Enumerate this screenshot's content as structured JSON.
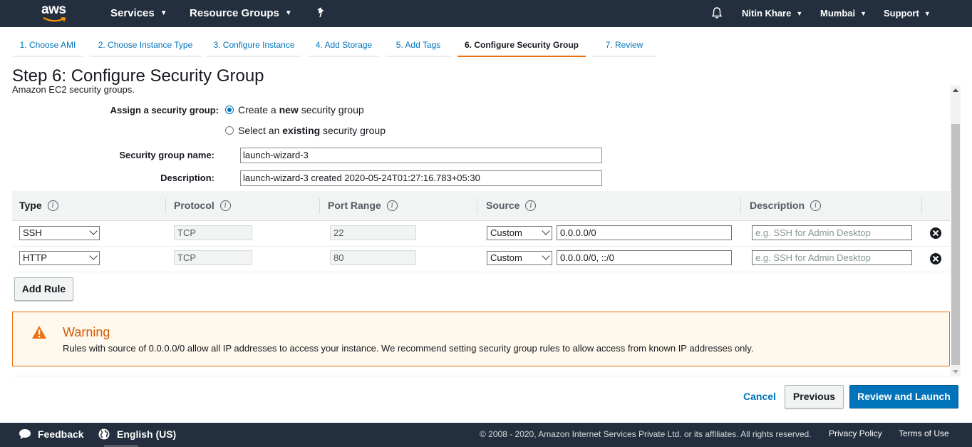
{
  "topnav": {
    "logo_text": "aws",
    "services": "Services",
    "resource_groups": "Resource Groups",
    "user": "Nitin Khare",
    "region": "Mumbai",
    "support": "Support"
  },
  "steps": [
    {
      "label": "1. Choose AMI",
      "active": false
    },
    {
      "label": "2. Choose Instance Type",
      "active": false
    },
    {
      "label": "3. Configure Instance",
      "active": false
    },
    {
      "label": "4. Add Storage",
      "active": false
    },
    {
      "label": "5. Add Tags",
      "active": false
    },
    {
      "label": "6. Configure Security Group",
      "active": true
    },
    {
      "label": "7. Review",
      "active": false
    }
  ],
  "page": {
    "title": "Step 6: Configure Security Group",
    "subtitle": "Amazon EC2 security groups."
  },
  "form": {
    "assign_label": "Assign a security group:",
    "option_new_pre": "Create a ",
    "option_new_bold": "new",
    "option_new_post": " security group",
    "option_existing_pre": "Select an ",
    "option_existing_bold": "existing",
    "option_existing_post": " security group",
    "selected_option": "new",
    "name_label": "Security group name:",
    "name_value": "launch-wizard-3",
    "desc_label": "Description:",
    "desc_value": "launch-wizard-3 created 2020-05-24T01:27:16.783+05:30"
  },
  "table": {
    "headers": {
      "type": "Type",
      "protocol": "Protocol",
      "port_range": "Port Range",
      "source": "Source",
      "description": "Description"
    },
    "info_glyph": "i",
    "rows": [
      {
        "type": "SSH",
        "protocol": "TCP",
        "port": "22",
        "source_type": "Custom",
        "source": "0.0.0.0/0",
        "description_placeholder": "e.g. SSH for Admin Desktop"
      },
      {
        "type": "HTTP",
        "protocol": "TCP",
        "port": "80",
        "source_type": "Custom",
        "source": "0.0.0.0/0, ::/0",
        "description_placeholder": "e.g. SSH for Admin Desktop"
      }
    ],
    "add_rule": "Add Rule"
  },
  "warning": {
    "title": "Warning",
    "text": "Rules with source of 0.0.0.0/0 allow all IP addresses to access your instance. We recommend setting security group rules to allow access from known IP addresses only."
  },
  "actions": {
    "cancel": "Cancel",
    "previous": "Previous",
    "review_launch": "Review and Launch"
  },
  "footer": {
    "feedback": "Feedback",
    "language": "English (US)",
    "copyright": "© 2008 - 2020, Amazon Internet Services Private Ltd. or its affiliates. All rights reserved.",
    "privacy": "Privacy Policy",
    "terms": "Terms of Use"
  },
  "colors": {
    "nav_bg": "#232f3e",
    "accent_orange": "#ec7211",
    "link_blue": "#0073bb",
    "primary_button": "#0073bb",
    "warning_bg": "#fef8ed"
  }
}
